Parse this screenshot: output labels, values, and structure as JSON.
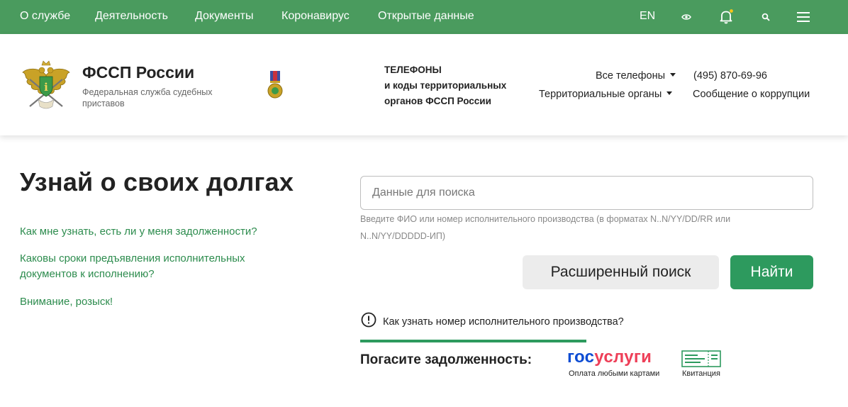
{
  "topnav": {
    "items": [
      {
        "label": "О службе"
      },
      {
        "label": "Деятельность"
      },
      {
        "label": "Документы"
      },
      {
        "label": "Коронавирус"
      },
      {
        "label": "Открытые данные"
      }
    ],
    "lang": "EN",
    "icons": [
      "eye-icon",
      "bell-icon",
      "search-icon",
      "menu-icon"
    ],
    "notification_dot_color": "#f5c518"
  },
  "header": {
    "org_name": "ФССП России",
    "org_subtitle": "Федеральная служба судебных приставов",
    "phones_block": {
      "line1": "ТЕЛЕФОНЫ",
      "line2": "и коды территориальных",
      "line3": "органов ФССП России"
    },
    "all_phones": "Все телефоны",
    "territorial": "Территориальные органы",
    "phone": "(495) 870-69-96",
    "corruption": "Сообщение о коррупции"
  },
  "main": {
    "title": "Узнай о своих долгах",
    "faq": [
      {
        "label": "Как мне узнать, есть ли у меня задолженности?"
      },
      {
        "label": "Каковы сроки предъявления исполнительных документов к исполнению?"
      },
      {
        "label": "Внимание, розыск!"
      }
    ],
    "search": {
      "placeholder": "Данные для поиска",
      "value": "",
      "hint": "Введите ФИО или номер исполнительного производства (в форматах N..N/YY/DD/RR или N..N/YY/DDDDD-ИП)"
    },
    "advanced_button": "Расширенный поиск",
    "find_button": "Найти",
    "info_link": "Как узнать номер исполнительного производства?",
    "pay": {
      "label": "Погасите задолженность:",
      "gosuslugi_part1": "гос",
      "gosuslugi_part2": "услуги",
      "gosuslugi_sub": "Оплата любыми картами",
      "receipt_sub": "Квитанция"
    }
  },
  "colors": {
    "nav_green": "#4a9b5e",
    "button_green": "#2d9a5e",
    "link_green": "#2d8c4e",
    "gos_blue": "#0d4cd3",
    "gos_red": "#ee3f58"
  }
}
